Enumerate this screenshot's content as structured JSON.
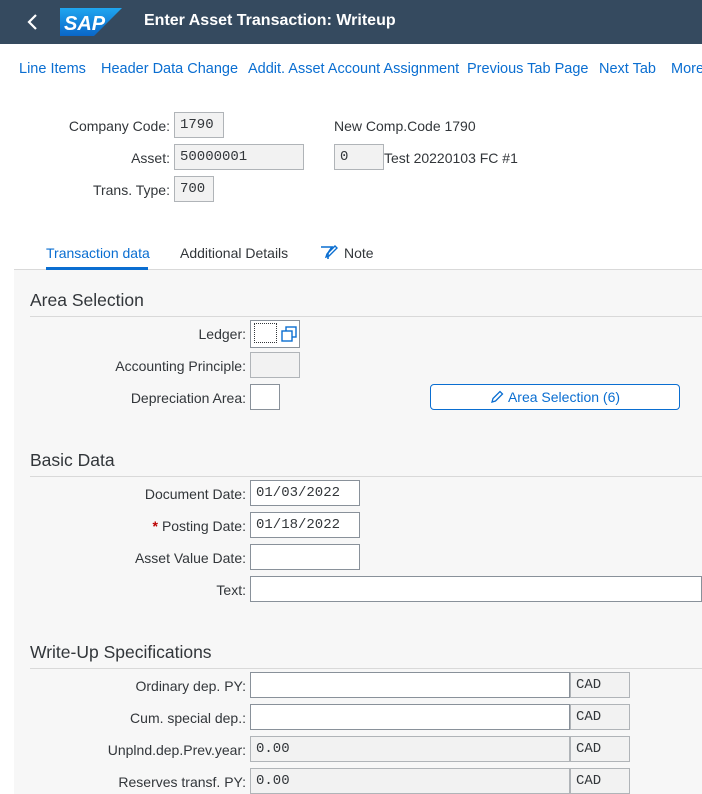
{
  "shell": {
    "title": "Enter Asset Transaction: Writeup",
    "logo_text": "SAP"
  },
  "toolbar": {
    "items": [
      "Line Items",
      "Header Data Change",
      "Addit. Asset Account Assignment",
      "Previous Tab Page",
      "Next Tab",
      "More"
    ]
  },
  "header": {
    "company_code_label": "Company Code:",
    "company_code_value": "1790",
    "new_comp_code_text": "New Comp.Code 1790",
    "asset_label": "Asset:",
    "asset_value": "50000001",
    "sub_number_value": "0",
    "asset_description": "Test 20220103 FC #1",
    "trans_type_label": "Trans. Type:",
    "trans_type_value": "700"
  },
  "tabs": [
    "Transaction data",
    "Additional Details",
    "Note"
  ],
  "area_selection": {
    "title": "Area Selection",
    "ledger_label": "Ledger:",
    "ledger_value": "",
    "accounting_principle_label": "Accounting Principle:",
    "accounting_principle_value": "",
    "depreciation_area_label": "Depreciation Area:",
    "depreciation_area_value": "",
    "area_button_label": "Area Selection (6)"
  },
  "basic_data": {
    "title": "Basic Data",
    "document_date_label": "Document Date:",
    "document_date_value": "01/03/2022",
    "posting_date_label": "Posting Date:",
    "posting_date_value": "01/18/2022",
    "required_marker": "*",
    "asset_value_date_label": "Asset Value Date:",
    "asset_value_date_value": "",
    "text_label": "Text:",
    "text_value": ""
  },
  "writeup": {
    "title": "Write-Up Specifications",
    "rows": [
      {
        "label": "Ordinary dep. PY:",
        "value": "",
        "currency": "CAD"
      },
      {
        "label": "Cum. special dep.:",
        "value": "",
        "currency": "CAD"
      },
      {
        "label": "Unplnd.dep.Prev.year:",
        "value": "0.00",
        "currency": "CAD"
      },
      {
        "label": "Reserves transf. PY:",
        "value": "0.00",
        "currency": "CAD"
      }
    ]
  },
  "colors": {
    "shell_bg": "#354a5f",
    "link": "#0a6ed1",
    "required": "#bb0000",
    "content_bg": "#f7f7f7"
  },
  "icons": {
    "back": "chevron-left-icon",
    "value_help": "value-help-icon",
    "edit": "pencil-icon",
    "note": "note-icon"
  }
}
